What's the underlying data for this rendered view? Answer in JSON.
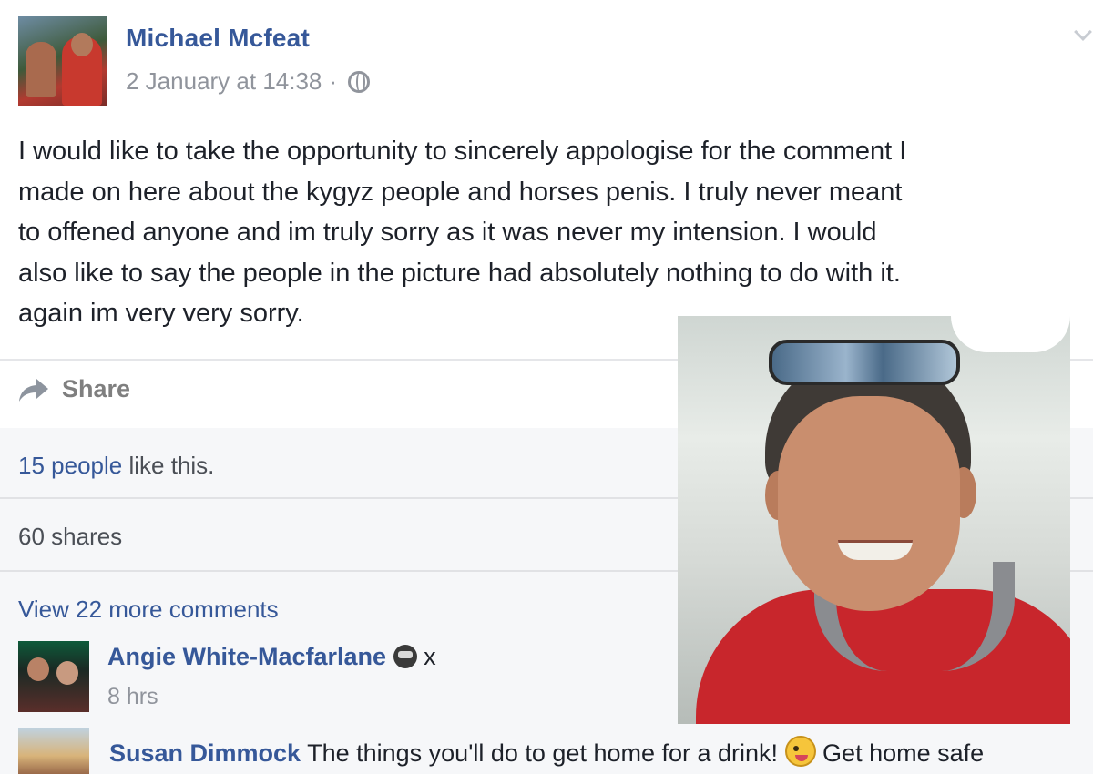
{
  "post": {
    "author": "Michael Mcfeat",
    "timestamp": "2 January at 14:38",
    "separator": "·",
    "privacy_icon": "globe-icon",
    "lines": [
      "I would like to take the opportunity to sincerely appologise for the comment I",
      "made on here about the kygyz people and horses penis. I truly never meant",
      "to offened anyone and im truly sorry as it was never my intension. I would",
      "also like to say the people in the picture had absolutely nothing to do with it.",
      "again im very very sorry."
    ],
    "share_label": "Share",
    "share_icon": "share-arrow-icon"
  },
  "feedback": {
    "likes_link": "15 people",
    "likes_rest": " like this.",
    "shares": "60 shares",
    "view_more": "View 22 more comments"
  },
  "comments": [
    {
      "name": "Angie White-Macfarlane",
      "emoji": "see-no-evil-monkey-icon",
      "text": " x",
      "time": "8 hrs"
    },
    {
      "name": "Susan Dimmock",
      "text_before": " The things you'll do to get home for a drink! ",
      "emoji": "winking-tongue-face-icon",
      "text_after": " Get home safe"
    }
  ],
  "colors": {
    "link": "#365899",
    "meta": "#90949c",
    "feedback_bg": "#f6f7f9"
  }
}
